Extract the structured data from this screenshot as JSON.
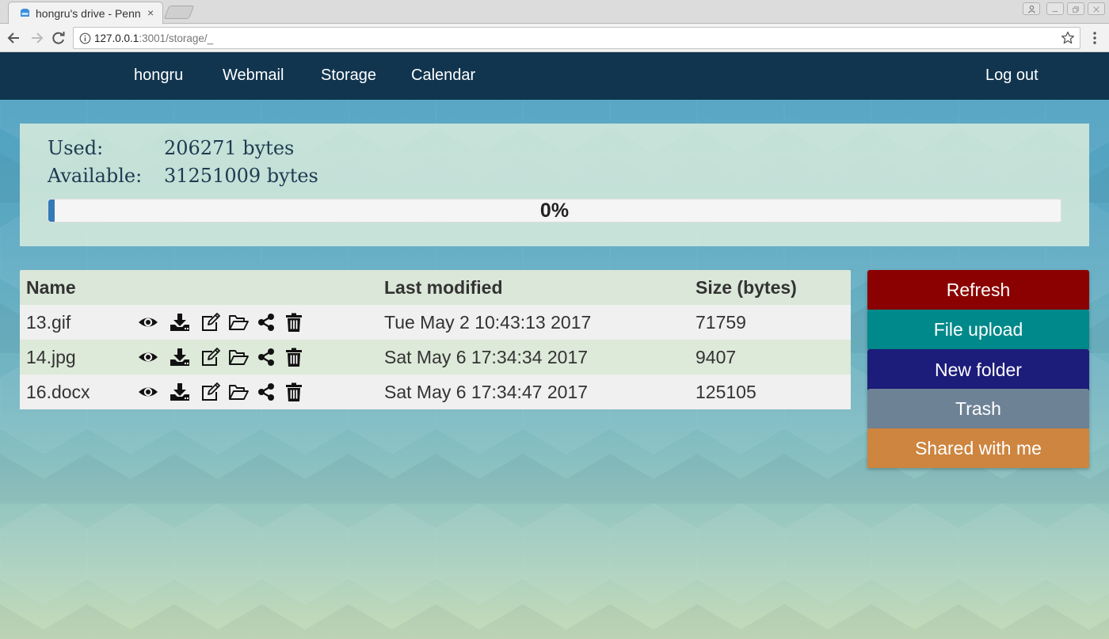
{
  "browser": {
    "tab_title": "hongru's drive - Penn",
    "tab_close": "×",
    "url_host": "127.0.0.1",
    "url_rest": ":3001/storage/_",
    "window_buttons": [
      "minimize",
      "restore",
      "close"
    ]
  },
  "nav": {
    "user": "hongru",
    "webmail": "Webmail",
    "storage": "Storage",
    "calendar": "Calendar",
    "logout": "Log out"
  },
  "quota": {
    "used_label": "Used:",
    "used_value": "206271 bytes",
    "available_label": "Available:",
    "available_value": "31251009 bytes",
    "percent_text": "0%",
    "percent_fill": 0.0066
  },
  "table": {
    "headers": {
      "name": "Name",
      "modified": "Last modified",
      "size": "Size (bytes)"
    },
    "rows": [
      {
        "name": "13.gif",
        "modified": "Tue May 2 10:43:13 2017",
        "size": "71759"
      },
      {
        "name": "14.jpg",
        "modified": "Sat May 6 17:34:34 2017",
        "size": "9407"
      },
      {
        "name": "16.docx",
        "modified": "Sat May 6 17:34:47 2017",
        "size": "125105"
      }
    ],
    "row_actions": [
      "eye-icon",
      "download-icon",
      "edit-icon",
      "folder-open-icon",
      "share-icon",
      "trash-icon"
    ]
  },
  "sidebar": {
    "refresh": "Refresh",
    "upload": "File upload",
    "new_folder": "New folder",
    "trash": "Trash",
    "shared": "Shared with me"
  },
  "colors": {
    "navbar": "#11354f",
    "refresh": "#8b0000",
    "upload": "#00898a",
    "new_folder": "#1c1c7a",
    "trash": "#6e8296",
    "shared": "#cd853f"
  }
}
